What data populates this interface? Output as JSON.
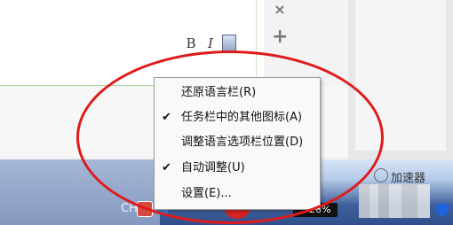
{
  "toolbar": {
    "bold_label": "B",
    "italic_label": "I"
  },
  "side_controls": {
    "close_label": "×",
    "add_label": "+"
  },
  "taskbar": {
    "cn_label": "CH",
    "accelerator_label": "加速器",
    "percent_label": "26%"
  },
  "context_menu": {
    "items": [
      {
        "label": "还原语言栏(R)",
        "checked": false
      },
      {
        "label": "任务栏中的其他图标(A)",
        "checked": true
      },
      {
        "label": "调整语言选项栏位置(D)",
        "checked": false
      },
      {
        "label": "自动调整(U)",
        "checked": true
      },
      {
        "label": "设置(E)...",
        "checked": false
      }
    ]
  },
  "colors": {
    "highlight": "#df1b1b",
    "taskbar_blue": "#3e5f9b"
  },
  "icons": {
    "bold": "bold-icon",
    "italic": "italic-icon",
    "strike": "format-icon",
    "close": "close-icon",
    "add": "add-icon",
    "language": "language-icon",
    "help": "help-icon",
    "shield": "shield-icon",
    "accelerator": "accelerator-icon"
  }
}
